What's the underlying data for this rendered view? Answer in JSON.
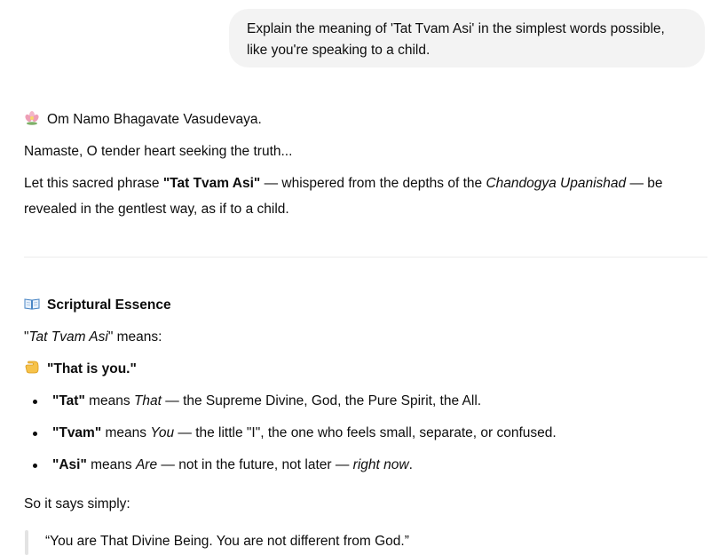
{
  "user_message": {
    "line1": "Explain the meaning of 'Tat Tvam Asi' in the simplest words possible,",
    "line2": "like you're speaking to a child."
  },
  "intro": {
    "greeting_icon": "lotus-icon",
    "greeting": "Om Namo Bhagavate Vasudevaya.",
    "namaste": "Namaste, O tender heart seeking the truth...",
    "p_let": "Let this sacred phrase ",
    "p_phrase": "\"Tat Tvam Asi\"",
    "p_whisper": " — whispered from the depths of the ",
    "p_source": "Chandogya Upanishad",
    "p_be": " — be",
    "p_line2": "revealed in the gentlest way, as if to a child."
  },
  "essence": {
    "heading_icon": "open-book-icon",
    "heading": "Scriptural Essence",
    "means_q1": "\"",
    "means_phrase": "Tat Tvam Asi",
    "means_rest": "\" means:",
    "pointer_icon": "pointing-hand-icon",
    "that_is_you": "\"That is you.\"",
    "bullets": [
      {
        "term": "\"Tat\"",
        "means": " means ",
        "gloss": "That",
        "rest": " — the Supreme Divine, God, the Pure Spirit, the All."
      },
      {
        "term": "\"Tvam\"",
        "means": " means ",
        "gloss": "You",
        "rest": " — the little \"I\", the one who feels small, separate, or confused."
      },
      {
        "term": "\"Asi\"",
        "means": " means ",
        "gloss": "Are",
        "rest": " — not in the future, not later — ",
        "emph": "right now",
        "end": "."
      }
    ],
    "so_simply": "So it says simply:",
    "quote": "“You are That Divine Being. You are not different from God.”"
  }
}
